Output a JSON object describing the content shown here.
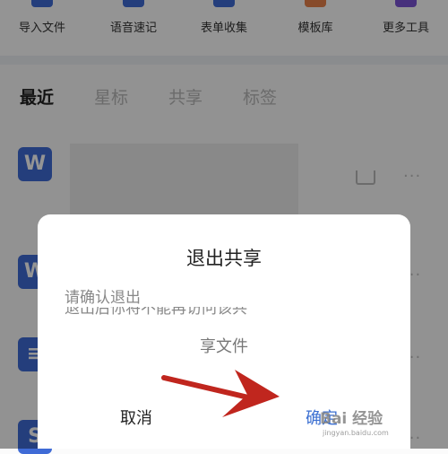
{
  "toolbar": {
    "items": [
      {
        "label": "导入文件",
        "icon": "import-file-icon",
        "color": "#3f6bd6"
      },
      {
        "label": "语音速记",
        "icon": "voice-memo-icon",
        "color": "#3f6bd6"
      },
      {
        "label": "表单收集",
        "icon": "form-collect-icon",
        "color": "#3f6bd6"
      },
      {
        "label": "模板库",
        "icon": "template-library-icon",
        "color": "#e8814a"
      },
      {
        "label": "更多工具",
        "icon": "more-tools-icon",
        "color": "#7b54d6"
      }
    ]
  },
  "tabs": [
    {
      "label": "最近",
      "active": true
    },
    {
      "label": "星标",
      "active": false
    },
    {
      "label": "共享",
      "active": false
    },
    {
      "label": "标签",
      "active": false
    }
  ],
  "files": [
    {
      "icon": "word-file-icon",
      "glyph": "W"
    },
    {
      "icon": "word-file-icon",
      "glyph": "W"
    },
    {
      "icon": "doc-file-icon",
      "glyph": "≡"
    },
    {
      "icon": "sheet-file-icon",
      "glyph": "S"
    }
  ],
  "more_glyph": "···",
  "dialog": {
    "title": "退出共享",
    "message_line1": "请确认退出",
    "message_partial": "退出后你将不能再访问该共",
    "message_line2": "享文件",
    "cancel_label": "取消",
    "confirm_label": "确定"
  },
  "watermark": {
    "text": "Bai 经验",
    "sub": "jingyan.baidu.com"
  },
  "colors": {
    "accent": "#3b6fd1",
    "arrow": "#c0261e"
  }
}
